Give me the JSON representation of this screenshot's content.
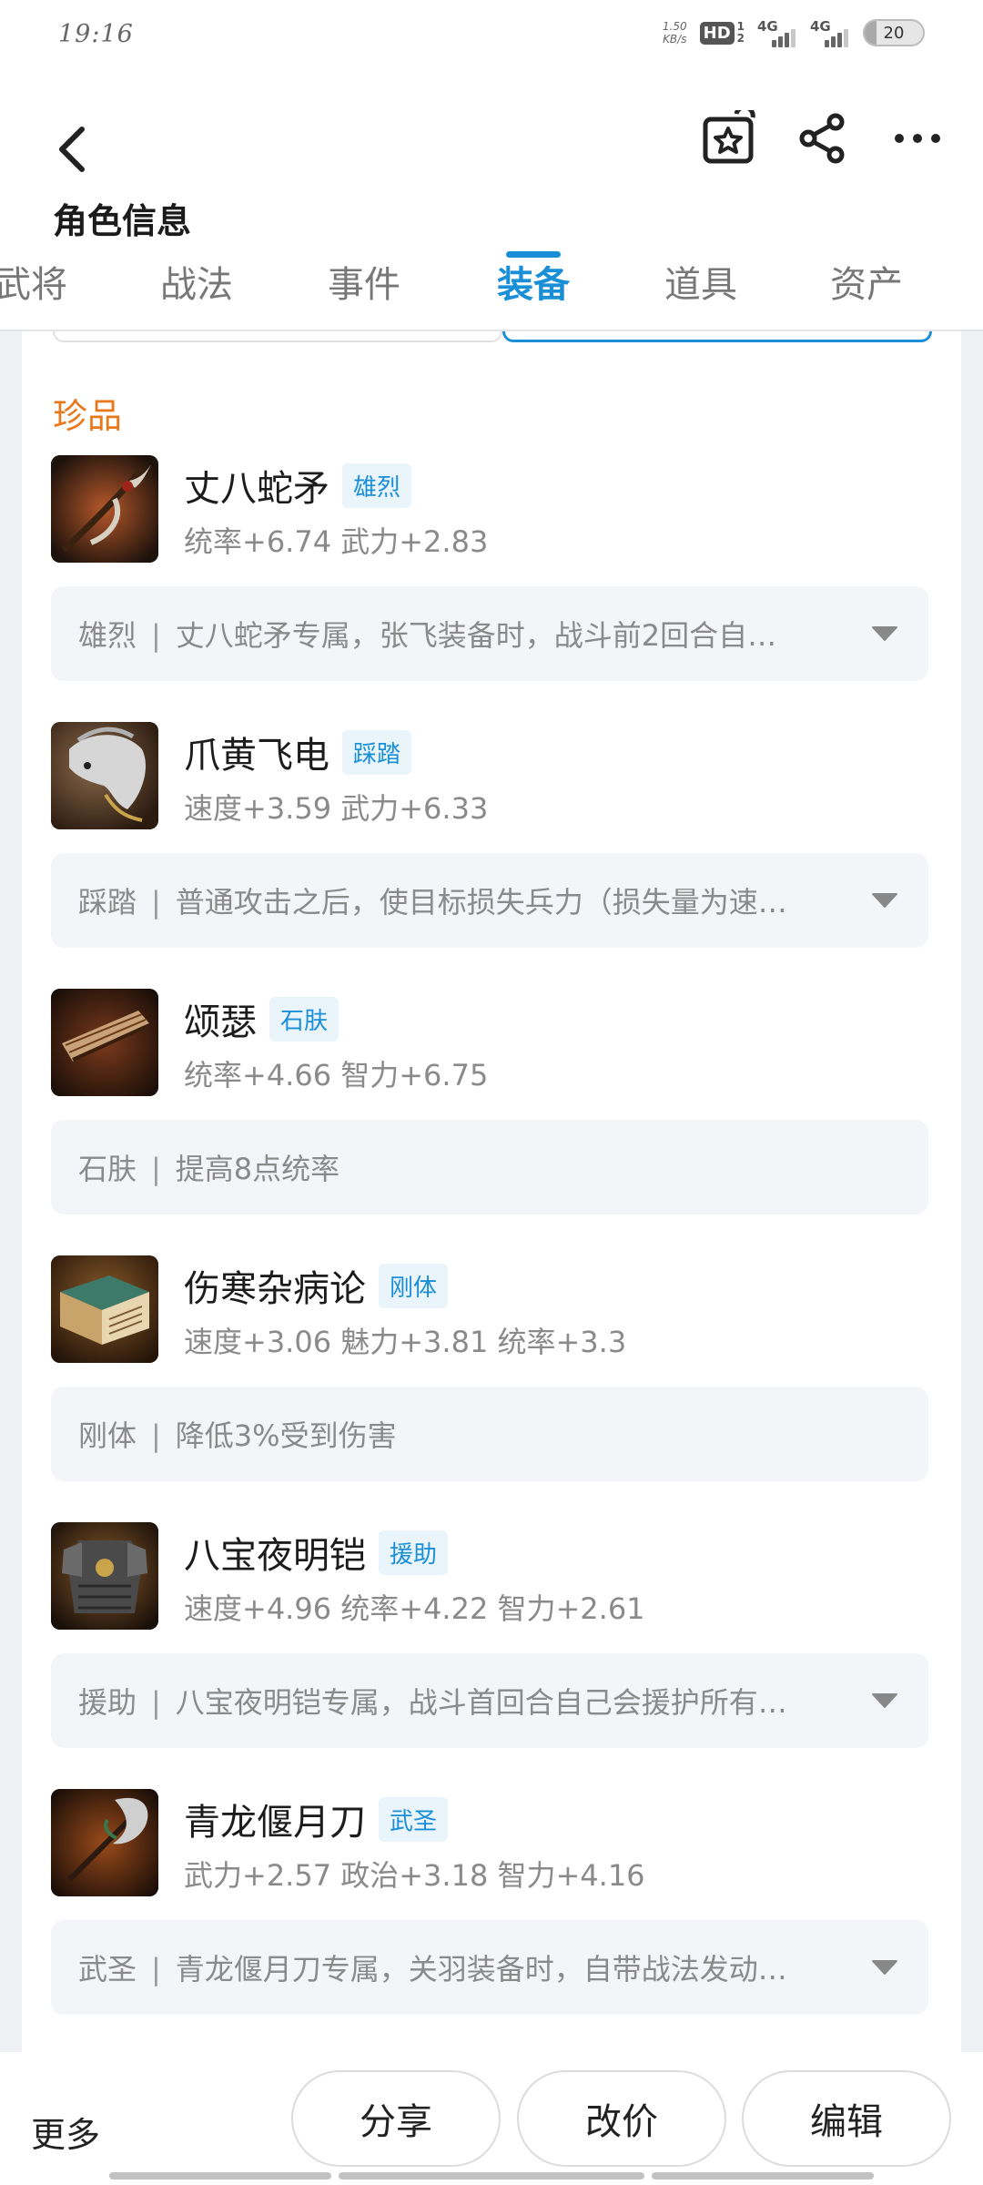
{
  "status_bar": {
    "time": "19:16",
    "net_speed_value": "1.50",
    "net_speed_unit": "KB/s",
    "hd_label": "HD",
    "hd_sub1": "1",
    "hd_sub2": "2",
    "signal1_label": "4G",
    "signal2_label": "4G",
    "battery": "20"
  },
  "header": {
    "title": "角色信息",
    "tabs": [
      {
        "label": "武将"
      },
      {
        "label": "战法"
      },
      {
        "label": "事件"
      },
      {
        "label": "装备",
        "active": true
      },
      {
        "label": "道具"
      },
      {
        "label": "资产"
      }
    ],
    "icons": [
      "back-arrow-icon",
      "favorite-star-icon",
      "share-icon",
      "more-icon"
    ],
    "accent_color": "#1a8fd8"
  },
  "section": {
    "title": "珍品",
    "title_color": "#e8781c"
  },
  "items": [
    {
      "name": "丈八蛇矛",
      "tag": "雄烈",
      "stats": "统率+6.74 武力+2.83",
      "skill_name": "雄烈",
      "skill_desc": "丈八蛇矛专属，张飞装备时，战斗前2回合自…",
      "expandable": true
    },
    {
      "name": "爪黄飞电",
      "tag": "踩踏",
      "stats": "速度+3.59 武力+6.33",
      "skill_name": "踩踏",
      "skill_desc": "普通攻击之后，使目标损失兵力（损失量为速…",
      "expandable": true
    },
    {
      "name": "颂瑟",
      "tag": "石肤",
      "stats": "统率+4.66 智力+6.75",
      "skill_name": "石肤",
      "skill_desc": "提高8点统率",
      "expandable": false
    },
    {
      "name": "伤寒杂病论",
      "tag": "刚体",
      "stats": "速度+3.06 魅力+3.81 统率+3.3",
      "skill_name": "刚体",
      "skill_desc": "降低3%受到伤害",
      "expandable": false
    },
    {
      "name": "八宝夜明铠",
      "tag": "援助",
      "stats": "速度+4.96 统率+4.22 智力+2.61",
      "skill_name": "援助",
      "skill_desc": "八宝夜明铠专属，战斗首回合自己会援护所有…",
      "expandable": true
    },
    {
      "name": "青龙偃月刀",
      "tag": "武圣",
      "stats": "武力+2.57 政治+3.18 智力+4.16",
      "skill_name": "武圣",
      "skill_desc": "青龙偃月刀专属，关羽装备时，自带战法发动…",
      "expandable": true
    }
  ],
  "skill_separator": "|",
  "bottom_bar": {
    "more_label": "更多",
    "share_label": "分享",
    "reprice_label": "改价",
    "edit_label": "编辑"
  }
}
